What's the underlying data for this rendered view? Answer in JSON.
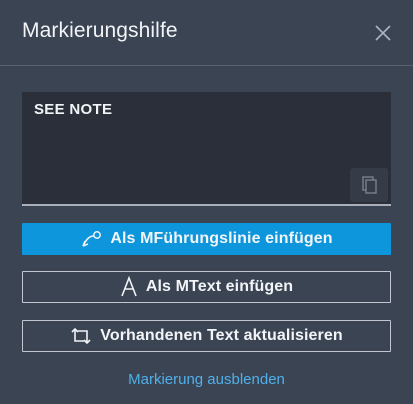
{
  "window": {
    "title": "Markierungshilfe"
  },
  "editor": {
    "text": "SEE NOTE"
  },
  "buttons": {
    "insert_mleader": "Als MFührungslinie einfügen",
    "insert_mtext": "Als MText einfügen",
    "update_text": "Vorhandenen Text aktualisieren"
  },
  "footer": {
    "hide_markup_link": "Markierung ausblenden"
  },
  "icons": {
    "close": "close-icon",
    "copy": "copy-icon",
    "mleader": "mleader-icon",
    "mtext": "text-a-icon",
    "update": "refresh-icon"
  },
  "colors": {
    "background": "#3b4453",
    "primary": "#0d96dc",
    "link": "#4fb0ea"
  }
}
